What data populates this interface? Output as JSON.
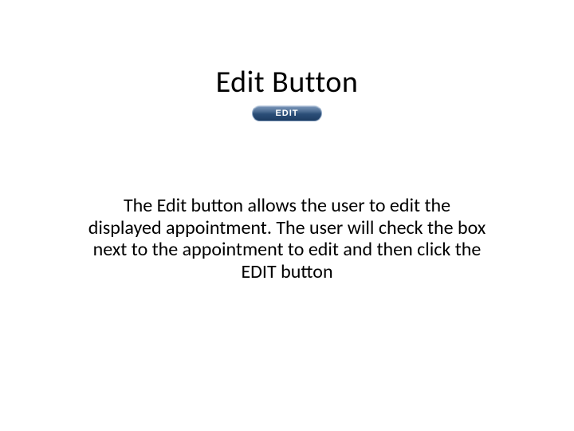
{
  "title": "Edit Button",
  "button": {
    "label": "EDIT"
  },
  "description": "The Edit button allows the user to edit the displayed appointment.  The user will check the box next to the appointment to edit and then click the EDIT button"
}
